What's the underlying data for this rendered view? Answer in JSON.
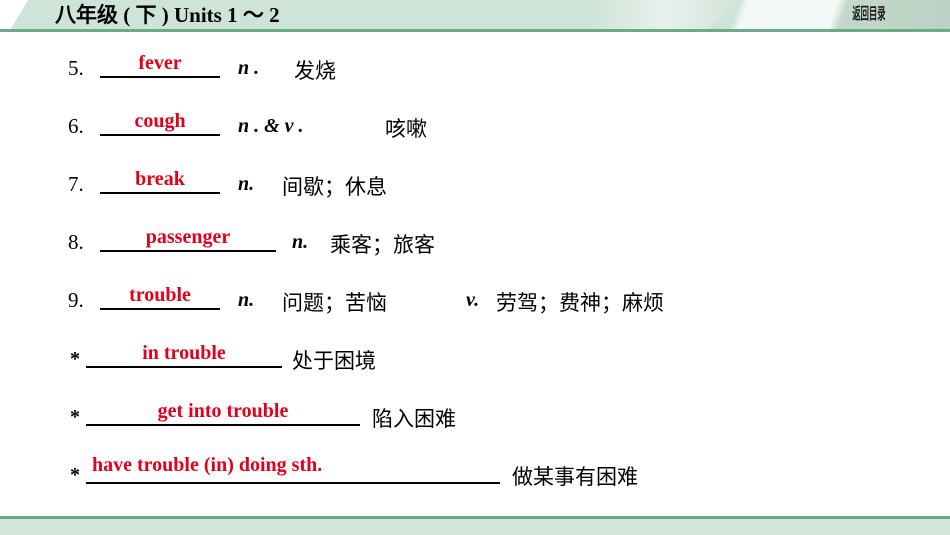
{
  "header": {
    "title": "八年级 ( 下 ) Units 1 ～ 2",
    "back_label": "返回目录",
    "band_color": "#cfe4d8",
    "rule_color": "#6aab82"
  },
  "footer": {
    "line_color": "#67a87f",
    "band_color": "#d4e6d9"
  },
  "answer_color": "#e2001a",
  "entries": [
    {
      "marker": "5.",
      "answer": "fever",
      "pos": "n .",
      "meaning": "发烧"
    },
    {
      "marker": "6.",
      "answer": "cough",
      "pos": "n .  & v .",
      "meaning": "咳嗽"
    },
    {
      "marker": "7.",
      "answer": "break",
      "pos": "n.",
      "meaning": "间歇；休息"
    },
    {
      "marker": "8.",
      "answer": "passenger",
      "pos": "n.",
      "meaning": "乘客；旅客"
    },
    {
      "marker": "9.",
      "answer": "trouble",
      "pos": "n.",
      "meaning": "问题；苦恼",
      "pos2": "v.",
      "meaning2": "劳驾；费神；麻烦"
    },
    {
      "marker": "*",
      "answer": "in trouble",
      "pos": "",
      "meaning": "处于困境"
    },
    {
      "marker": "*",
      "answer": "get into trouble",
      "pos": "",
      "meaning": "陷入困难"
    },
    {
      "marker": "*",
      "answer": "have trouble (in) doing sth.",
      "pos": "",
      "meaning": "做某事有困难"
    }
  ]
}
